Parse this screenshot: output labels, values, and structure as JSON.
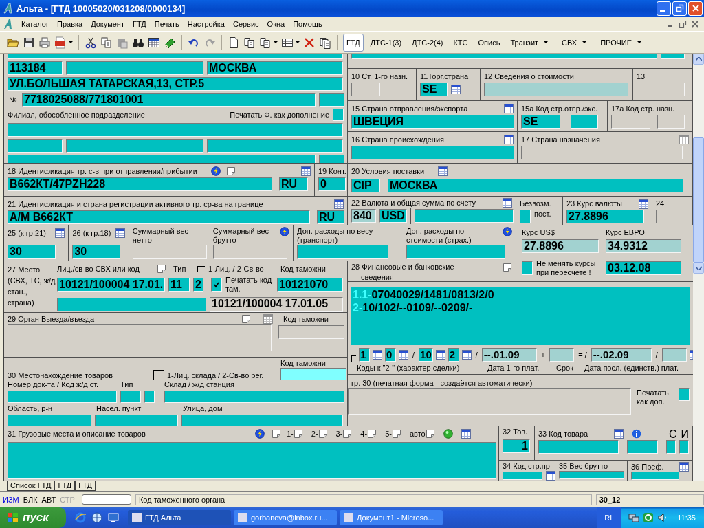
{
  "window": {
    "title": "Альта - [ГТД 10005020/031208/0000134]"
  },
  "menu": [
    "Каталог",
    "Правка",
    "Документ",
    "ГТД",
    "Печать",
    "Настройка",
    "Сервис",
    "Окна",
    "Помощь"
  ],
  "doc_tabs": [
    {
      "label": "ГТД",
      "selected": true,
      "dropdown": false
    },
    {
      "label": "ДТС-1(3)",
      "selected": false,
      "dropdown": false
    },
    {
      "label": "ДТС-2(4)",
      "selected": false,
      "dropdown": false
    },
    {
      "label": "КТС",
      "selected": false,
      "dropdown": false
    },
    {
      "label": "Опись",
      "selected": false,
      "dropdown": false
    },
    {
      "label": "Транзит",
      "selected": false,
      "dropdown": true
    },
    {
      "label": "СВХ",
      "selected": false,
      "dropdown": true
    },
    {
      "label": "ПРОЧИЕ",
      "selected": false,
      "dropdown": true
    }
  ],
  "form": {
    "consignee": {
      "postcode": "113184",
      "city": "МОСКВА",
      "street": "УЛ.БОЛЬШАЯ ТАТАРСКАЯ,13, СТР.5",
      "number_sign": "№",
      "tax_id": "7718025088/771801001",
      "branch_label": "Филиал, обособленное подразделение",
      "print_label": "Печатать Ф. как дополнение",
      "print_checked": false
    },
    "b10": {
      "label": "10 Ст. 1-го назн."
    },
    "b11": {
      "label": "11Торг.страна",
      "value": "SE"
    },
    "b12": {
      "label": "12 Сведения о стоимости"
    },
    "b13": {
      "label": "13"
    },
    "b15": {
      "label": "15 Страна отправления/экспорта",
      "value": "ШВЕЦИЯ"
    },
    "b15a": {
      "label": "15а Код стр.отпр./экс.",
      "value": "SE"
    },
    "b17a": {
      "label": "17а Код стр. назн."
    },
    "b16": {
      "label": "16 Страна происхождения"
    },
    "b17": {
      "label": "17 Страна назначения"
    },
    "b18": {
      "label": "18 Идентификация тр. с-в при отправлении/прибытии",
      "value": "В662КТ/47PZH228",
      "country": "RU"
    },
    "b19": {
      "label": "19 Конт.",
      "value": "0"
    },
    "b20": {
      "label": "20 Условия поставки",
      "terms": "CIP",
      "place": "МОСКВА"
    },
    "b21": {
      "label": "21 Идентификация и страна регистрации активного тр. ср-ва на границе",
      "value": "А/М В662КТ",
      "country": "RU"
    },
    "b22": {
      "label": "22 Валюта и общая сумма по счету",
      "code": "840",
      "currency": "USD"
    },
    "free": {
      "label_top": "Безвозм.",
      "label_bottom": "пост.",
      "checked": false
    },
    "b23": {
      "label": "23 Курс валюты",
      "value": "27.8896"
    },
    "b24": {
      "label": "24"
    },
    "b25": {
      "label": "25 (к гр.21)",
      "value": "30"
    },
    "b26": {
      "label": "26 (к гр.18)",
      "value": "30"
    },
    "net": {
      "label": "Суммарный вес нетто"
    },
    "gross": {
      "label": "Суммарный вес брутто"
    },
    "extra_weight": {
      "label": "Доп. расходы по весу (транспорт)"
    },
    "extra_value": {
      "label": "Доп. расходы по стоимости (страх.)"
    },
    "rates": {
      "usd_label": "Курс US$",
      "usd": "27.8896",
      "eur_label": "Курс ЕВРО",
      "eur": "34.9312",
      "lock_label": "Не менять курсы при пересчете !",
      "lock_checked": false,
      "date": "03.12.08"
    },
    "b27": {
      "label": "27  Место (СВХ, ТС, ж/д стан., страна)",
      "code_label": "Лиц./св-во СВХ или код",
      "code": "10121/100004 17.01.",
      "type_label": "Тип",
      "type": "11",
      "kind_label": "1-Лиц. / 2-Св-во",
      "kind": "2",
      "print_label": "Печатать код там.",
      "print_checked": true,
      "customs_label": "Код таможни",
      "customs": "10121070",
      "summary": "10121/100004 17.01.05"
    },
    "b28": {
      "label": "28 Финансовые и банковские",
      "label_2": "сведения",
      "lines": [
        {
          "num": "1.1-",
          "text": "07040029/1481/0813/2/0"
        },
        {
          "num": "2-",
          "text": "10/102/--0109/--0209/-"
        }
      ],
      "codes": [
        "1",
        "0",
        "10",
        "2"
      ],
      "slash": "/",
      "date_1": "--.01.09",
      "plus": "+",
      "equals": "= /",
      "date_2": "--.02.09",
      "slash_2": "/",
      "codes_label": "Коды к \"2-\" (характер сделки)",
      "date_1_label": "Дата 1-го плат.",
      "term_label": "Срок",
      "date_2_label": "Дата посл. (единств.) плат."
    },
    "b29": {
      "label": "29 Орган Выезда/въезда",
      "customs_label": "Код таможни"
    },
    "b30": {
      "label": "30 Местонахождение товаров",
      "kind_label": "1-Лиц. склада / 2-Св-во рег.",
      "customs_label": "Код таможни",
      "doc_label": "Номер док-та / Код ж/д ст.",
      "type_label": "Тип",
      "store_label": "Склад / ж/д станция",
      "region_label": "Область, р-н",
      "town_label": "Насел. пункт",
      "street_label": "Улица, дом"
    },
    "print30": {
      "label": "гр. 30 (печатная форма - создаётся автоматически)",
      "print_label": "Печатать как доп.",
      "checked": false
    },
    "b31": {
      "label": "31 Грузовые места и описание товаров",
      "sheets": [
        "1-",
        "2-",
        "3-",
        "4-",
        "5-"
      ],
      "auto": "авто"
    },
    "b32": {
      "label": "32 Тов.",
      "value": "1"
    },
    "b33": {
      "label": "33 Код товара",
      "c": "С",
      "i": "И"
    },
    "b34": {
      "label": "34 Код стр.пр"
    },
    "b35": {
      "label": "35 Вес брутто"
    },
    "b36": {
      "label": "36 Преф."
    }
  },
  "sheet_tabs": [
    {
      "label": "Список ГТД"
    },
    {
      "label": "ГТД"
    },
    {
      "label": "ГТД"
    }
  ],
  "status": {
    "modes": [
      {
        "label": "ИЗМ",
        "active": true,
        "disabled": false
      },
      {
        "label": "БЛК",
        "active": false,
        "disabled": false
      },
      {
        "label": "АВТ",
        "active": false,
        "disabled": false
      },
      {
        "label": "СТР",
        "active": false,
        "disabled": true
      }
    ],
    "hint": "Код таможенного органа",
    "code": "30_12"
  },
  "taskbar": {
    "start": "пуск",
    "tasks": [
      {
        "label": "ГТД Альта",
        "selected": true
      },
      {
        "label": "gorbaneva@inbox.ru...",
        "selected": false
      },
      {
        "label": "Документ1 - Microso...",
        "selected": false
      }
    ],
    "lang": "RL",
    "clock": "11:35"
  }
}
